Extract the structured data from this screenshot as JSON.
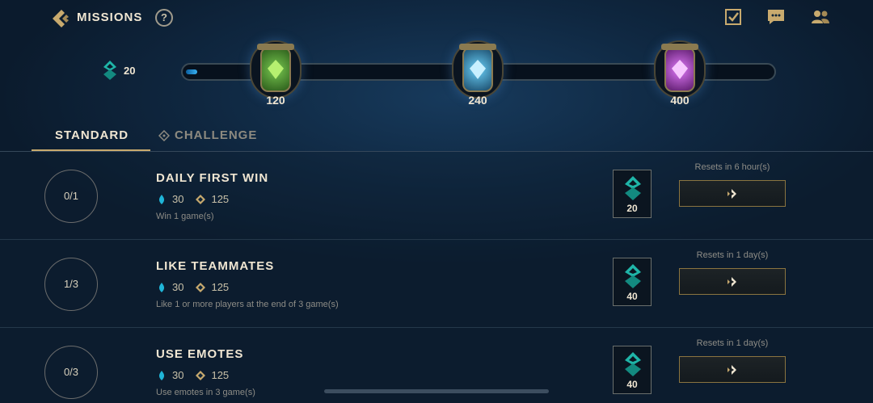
{
  "header": {
    "title": "MISSIONS",
    "help_label": "?",
    "back_icon": "back-chevron-icon",
    "icons": [
      "missions-checklist-icon",
      "chat-icon",
      "friends-icon"
    ]
  },
  "progress": {
    "current_points": "20",
    "fill_fraction": 0.02,
    "milestones": [
      {
        "label": "120",
        "color": "#5aa832"
      },
      {
        "label": "240",
        "color": "#3aa8d8"
      },
      {
        "label": "400",
        "color": "#c04ed8"
      }
    ]
  },
  "tabs": {
    "standard": "STANDARD",
    "challenge": "CHALLENGE"
  },
  "missions": [
    {
      "progress": "0/1",
      "title": "DAILY FIRST WIN",
      "blue_essence": "30",
      "gold": "125",
      "description": "Win 1 game(s)",
      "pass_points": "20",
      "reset": "Resets in 6 hour(s)"
    },
    {
      "progress": "1/3",
      "title": "LIKE TEAMMATES",
      "blue_essence": "30",
      "gold": "125",
      "description": "Like 1 or more players at the end of 3 game(s)",
      "pass_points": "40",
      "reset": "Resets in 1 day(s)"
    },
    {
      "progress": "0/3",
      "title": "USE EMOTES",
      "blue_essence": "30",
      "gold": "125",
      "description": "Use emotes in 3 game(s)",
      "pass_points": "40",
      "reset": "Resets in 1 day(s)"
    }
  ],
  "colors": {
    "gold": "#c8aa6e",
    "accent_blue": "#38b0f0",
    "teal": "#1fb5a8"
  }
}
